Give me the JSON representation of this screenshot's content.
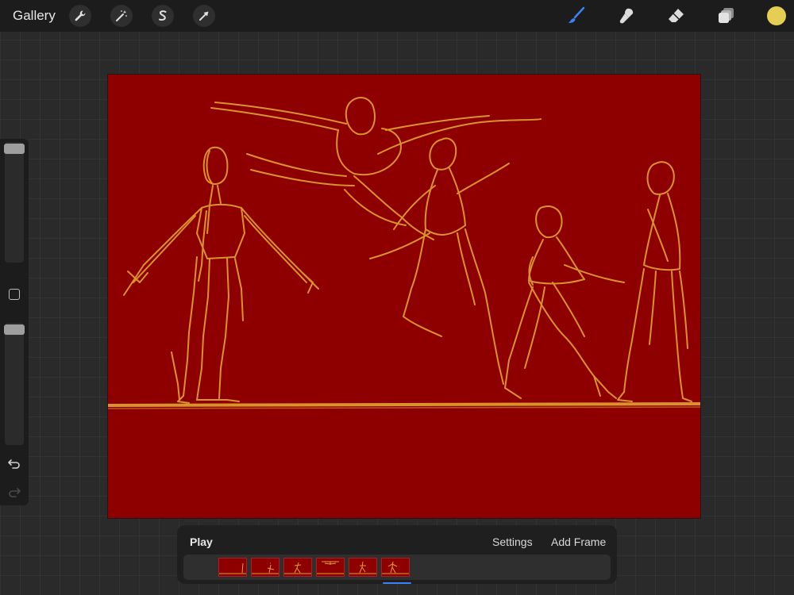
{
  "topbar": {
    "gallery_label": "Gallery",
    "left_tools": [
      {
        "name": "actions",
        "icon": "wrench-icon"
      },
      {
        "name": "adjustments",
        "icon": "magic-wand-icon"
      },
      {
        "name": "selection",
        "icon": "selection-s-icon"
      },
      {
        "name": "transform",
        "icon": "arrow-cursor-icon"
      }
    ],
    "right_tools": [
      {
        "name": "brush",
        "icon": "brush-icon",
        "active": true
      },
      {
        "name": "smudge",
        "icon": "smudge-icon"
      },
      {
        "name": "eraser",
        "icon": "eraser-icon"
      },
      {
        "name": "layers",
        "icon": "layers-icon"
      }
    ],
    "current_color": "#e5cf52",
    "active_tool_color": "#3a82f6"
  },
  "sidebar": {
    "size_slider_level": 0.0,
    "opacity_slider_level": 0.0,
    "buttons": [
      "modify-square-icon",
      "undo-icon",
      "redo-icon"
    ]
  },
  "canvas": {
    "background_color": "#8e0000",
    "stroke_color": "#e0a030"
  },
  "animation_panel": {
    "play_label": "Play",
    "settings_label": "Settings",
    "add_frame_label": "Add Frame",
    "frame_count": 6,
    "selected_frame": 6
  }
}
